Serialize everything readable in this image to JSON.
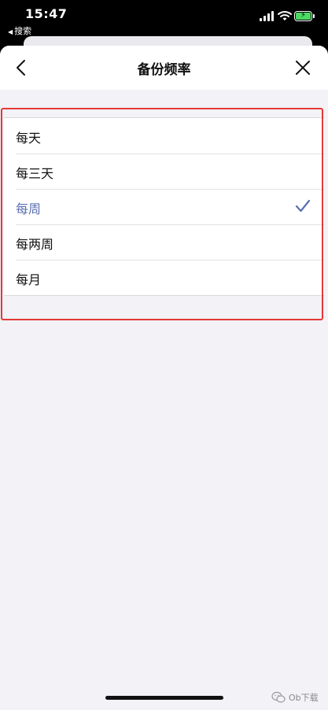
{
  "status_bar": {
    "time": "15:47",
    "back_app": "搜索",
    "battery_color": "#4cd964"
  },
  "nav": {
    "title": "备份频率",
    "back_icon": "chevron-left-icon",
    "close_icon": "close-icon"
  },
  "options": [
    {
      "label": "每天",
      "selected": false
    },
    {
      "label": "每三天",
      "selected": false
    },
    {
      "label": "每周",
      "selected": true
    },
    {
      "label": "每两周",
      "selected": false
    },
    {
      "label": "每月",
      "selected": false
    }
  ],
  "selected_color": "#5b6fb0",
  "highlight_color": "#e53935",
  "watermark": {
    "text": "Ob下载",
    "icon": "wechat-icon"
  }
}
